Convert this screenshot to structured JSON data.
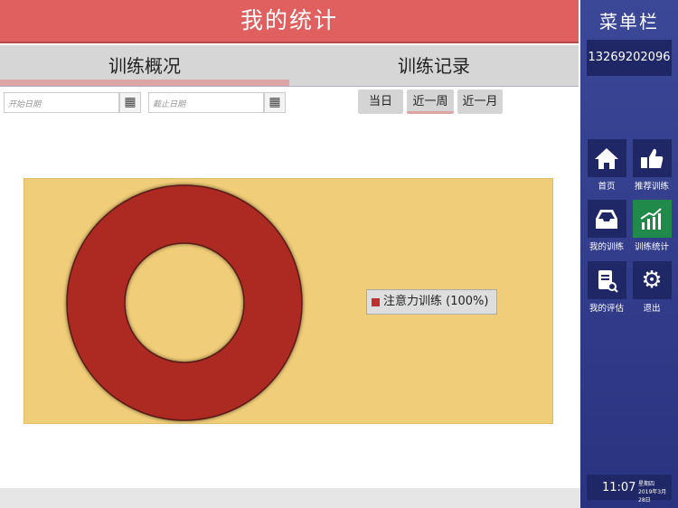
{
  "header": {
    "title": "我的统计"
  },
  "tabs": [
    {
      "label": "训练概况",
      "active": true
    },
    {
      "label": "训练记录",
      "active": false
    }
  ],
  "filters": {
    "start_placeholder": "开始日期",
    "end_placeholder": "截止日期",
    "quick": [
      {
        "label": "当日"
      },
      {
        "label": "近一周",
        "active": true
      },
      {
        "label": "近一月"
      }
    ]
  },
  "sidebar": {
    "title": "菜单栏",
    "phone": "13269202096",
    "items": [
      {
        "label": "首页",
        "icon": "home-icon"
      },
      {
        "label": "推荐训练",
        "icon": "thumbs-up-icon"
      },
      {
        "label": "我的训练",
        "icon": "inbox-icon"
      },
      {
        "label": "训练统计",
        "icon": "chart-icon",
        "active": true
      },
      {
        "label": "我的评估",
        "icon": "report-search-icon"
      },
      {
        "label": "退出",
        "icon": "gear-icon"
      }
    ],
    "time": "11:07",
    "weekday": "星期四",
    "date": "2019年3月28日"
  },
  "colors": {
    "header": "#e06060",
    "panel": "#f0cd78",
    "slice": "#ac2a24",
    "sidebar": "#2a3380",
    "active": "#1f8a4a"
  },
  "chart_data": {
    "type": "pie",
    "donut": true,
    "categories": [
      "注意力训练"
    ],
    "values": [
      100
    ],
    "legend": [
      "注意力训练 (100%)"
    ],
    "legend_position": "right"
  }
}
